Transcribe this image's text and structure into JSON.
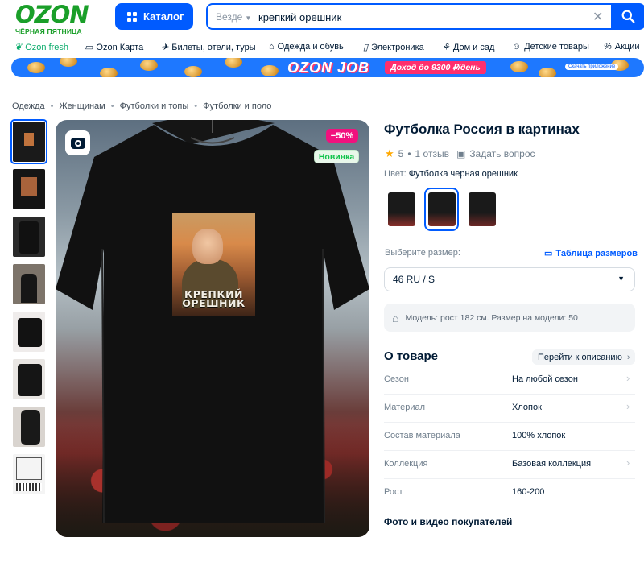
{
  "header": {
    "logo_text": "OZON",
    "logo_subtext": "ЧЁРНАЯ ПЯТНИЦА",
    "catalog_label": "Каталог",
    "search_scope": "Везде",
    "search_value": "крепкий орешник",
    "brand_color": "#005bff",
    "logo_color": "#1a9f29"
  },
  "nav": [
    {
      "label": "Ozon fresh",
      "icon": "leaf-icon"
    },
    {
      "label": "Ozon Карта",
      "icon": "card-icon"
    },
    {
      "label": "Билеты, отели, туры",
      "icon": "plane-icon"
    },
    {
      "label": "Одежда и обувь",
      "icon": "hanger-icon"
    },
    {
      "label": "Электроника",
      "icon": "phone-icon"
    },
    {
      "label": "Дом и сад",
      "icon": "home-icon"
    },
    {
      "label": "Детские товары",
      "icon": "toy-icon"
    },
    {
      "label": "Акции",
      "icon": "percent-icon"
    }
  ],
  "banner": {
    "title": "OZON JOB",
    "pill": "Доход до 9300 ₽/день",
    "app_label": "Скачать приложение"
  },
  "breadcrumbs": [
    "Одежда",
    "Женщинам",
    "Футболки и топы",
    "Футболки и поло"
  ],
  "gallery": {
    "sale_badge": "−50%",
    "new_badge": "Новинка",
    "print_text_line1": "КРЕПКИЙ",
    "print_text_line2": "ОРЕШНИК",
    "thumbnail_count": 8,
    "selected_thumbnail": 1
  },
  "product": {
    "title": "Футболка Россия в картинах",
    "rating": "5",
    "reviews": "1 отзыв",
    "ask_question": "Задать вопрос",
    "color_label": "Цвет:",
    "color_value": "Футболка черная орешник",
    "size_label": "Выберите размер:",
    "size_table_link": "Таблица размеров",
    "size_value": "46 RU / S",
    "model_info": "Модель: рост 182 см. Размер на модели: 50",
    "about_title": "О товаре",
    "goto_description": "Перейти к описанию",
    "attributes": [
      {
        "key": "Сезон",
        "value": "На любой сезон"
      },
      {
        "key": "Материал",
        "value": "Хлопок"
      },
      {
        "key": "Состав материала",
        "value": "100% хлопок"
      },
      {
        "key": "Коллекция",
        "value": "Базовая коллекция"
      },
      {
        "key": "Рост",
        "value": "160-200"
      }
    ],
    "photos_title": "Фото и видео покупателей"
  }
}
